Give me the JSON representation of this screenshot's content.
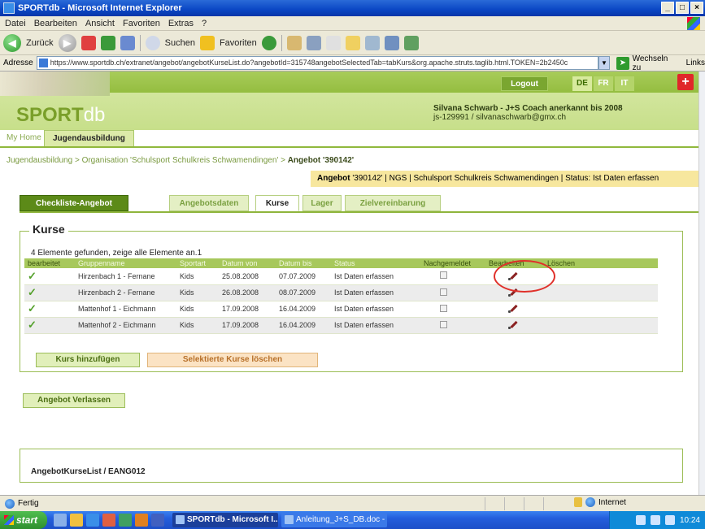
{
  "window": {
    "title": "SPORTdb - Microsoft Internet Explorer",
    "buttons": [
      "_",
      "□",
      "×"
    ]
  },
  "menu": [
    "Datei",
    "Bearbeiten",
    "Ansicht",
    "Favoriten",
    "Extras",
    "?"
  ],
  "toolbar": {
    "back": "Zurück",
    "search": "Suchen",
    "favorites": "Favoriten"
  },
  "address": {
    "label": "Adresse",
    "url": "https://www.sportdb.ch/extranet/angebot/angebotKurseList.do?angebotId=315748angebotSelectedTab=tabKurs&org.apache.struts.taglib.html.TOKEN=2b2450c",
    "go": "Wechseln zu",
    "links": "Links"
  },
  "site": {
    "logo_main": "SPORT",
    "logo_db": "db",
    "logout": "Logout",
    "languages": [
      {
        "code": "DE",
        "active": true
      },
      {
        "code": "FR",
        "active": false
      },
      {
        "code": "IT",
        "active": false
      }
    ],
    "user_name": "Silvana Schwarb - J+S Coach anerkannt bis 2008",
    "user_sub": "js-129991 / silvanaschwarb@gmx.ch"
  },
  "nav": {
    "my_home": "My Home",
    "jugend": "Jugendausbildung"
  },
  "breadcrumb": {
    "path": "Jugendausbildung > Organisation 'Schulsport Schulkreis Schwamendingen' >",
    "current": "Angebot '390142'"
  },
  "infobar": {
    "label": "Angebot",
    "text": " '390142' | NGS | Schulsport Schulkreis Schwamendingen | Status: Ist Daten erfassen"
  },
  "tabs": {
    "checklist": "Checkliste-Angebot",
    "items": [
      {
        "label": "Angebotsdaten",
        "active": false
      },
      {
        "label": "Kurse",
        "active": true
      },
      {
        "label": "Lager",
        "active": false
      },
      {
        "label": "Zielvereinbarung",
        "active": false
      }
    ]
  },
  "kurse": {
    "legend": "Kurse",
    "found": "4 Elemente gefunden, zeige alle Elemente an.1",
    "columns": [
      "bearbeitet",
      "Gruppenname",
      "Sportart",
      "Datum von",
      "Datum bis",
      "Status",
      "Nachgemeldet",
      "Bearbeiten",
      "Löschen"
    ],
    "rows": [
      {
        "name": "Hirzenbach 1 - Fernane",
        "sport": "Kids",
        "from": "25.08.2008",
        "to": "07.07.2009",
        "status": "Ist Daten erfassen"
      },
      {
        "name": "Hirzenbach 2 - Fernane",
        "sport": "Kids",
        "from": "26.08.2008",
        "to": "08.07.2009",
        "status": "Ist Daten erfassen"
      },
      {
        "name": "Mattenhof 1 - Eichmann",
        "sport": "Kids",
        "from": "17.09.2008",
        "to": "16.04.2009",
        "status": "Ist Daten erfassen"
      },
      {
        "name": "Mattenhof 2 - Eichmann",
        "sport": "Kids",
        "from": "17.09.2008",
        "to": "16.04.2009",
        "status": "Ist Daten erfassen"
      }
    ],
    "add_button": "Kurs hinzufügen",
    "delete_button": "Selektierte Kurse löschen"
  },
  "leave_button": "Angebot Verlassen",
  "footer_id": "AngebotKurseList / EANG012",
  "status": {
    "done": "Fertig",
    "zone": "Internet"
  },
  "taskbar": {
    "start": "start",
    "items": [
      {
        "label": "SPORTdb - Microsoft I...",
        "active": true
      },
      {
        "label": "Anleitung_J+S_DB.doc - ...",
        "active": false
      }
    ],
    "clock": "10:24"
  }
}
